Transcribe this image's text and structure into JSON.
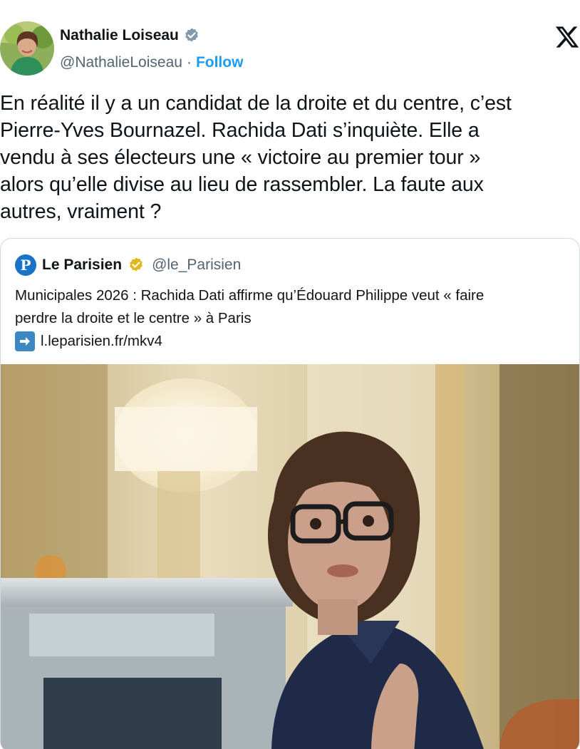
{
  "author": {
    "display_name": "Nathalie Loiseau",
    "handle": "@NathalieLoiseau",
    "separator": "·",
    "follow_label": "Follow"
  },
  "tweet": {
    "text": "En réalité il y a un candidat de la droite et du centre, c’est\nPierre-Yves Bournazel. Rachida Dati s’inquiète. Elle a\nvendu à ses électeurs une « victoire au premier tour »\nalors qu’elle divise au lieu de rassembler. La faute aux\nautres, vraiment ?"
  },
  "quote": {
    "logo_letter": "P",
    "display_name": "Le Parisien",
    "handle": "@le_Parisien",
    "text_line1": "Municipales 2026 : Rachida Dati affirme qu’Édouard Philippe veut « faire",
    "text_line2": "perdre la droite et le centre » à Paris",
    "link": "l.leparisien.fr/mkv4"
  },
  "icons": {
    "verified_author": "verified-badge-icon",
    "verified_quote": "gold-verified-badge-icon",
    "x_logo": "x-logo-icon",
    "link_arrow": "right-arrow-icon"
  },
  "colors": {
    "accent": "#1d9bf0",
    "text": "#0f1419",
    "muted": "#536471",
    "border": "#cfd9de",
    "gold_badge": "#e2b719"
  }
}
